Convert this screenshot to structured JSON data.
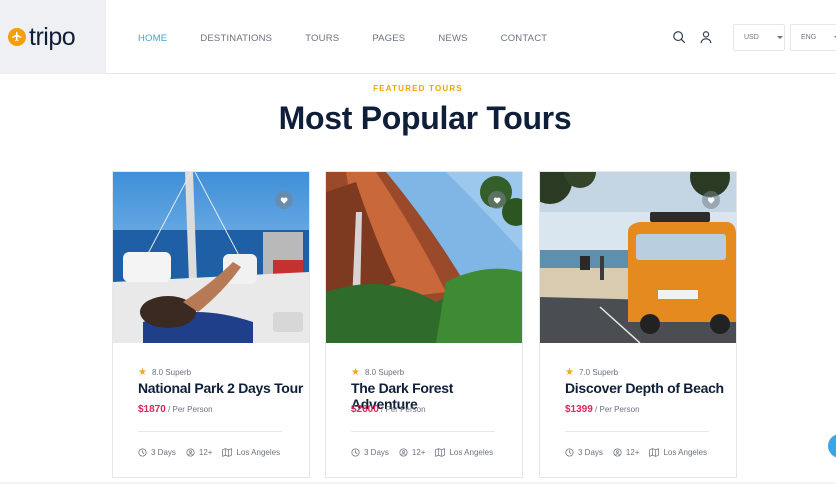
{
  "brand": {
    "name": "tripo",
    "accent": "#f59e0b"
  },
  "nav": {
    "items": [
      {
        "label": "HOME",
        "active": true
      },
      {
        "label": "DESTINATIONS",
        "active": false
      },
      {
        "label": "TOURS",
        "active": false
      },
      {
        "label": "PAGES",
        "active": false
      },
      {
        "label": "NEWS",
        "active": false
      },
      {
        "label": "CONTACT",
        "active": false
      }
    ]
  },
  "header": {
    "icons": [
      "search-icon",
      "user-icon"
    ],
    "currency": "USD",
    "language": "ENG"
  },
  "section": {
    "eyebrow": "FEATURED TOURS",
    "title": "Most Popular Tours"
  },
  "tours": [
    {
      "rating": "8.0 Superb",
      "title": "National Park 2 Days Tour",
      "price": "$1870",
      "per": "/ Per Person",
      "duration": "3 Days",
      "age": "12+",
      "location": "Los Angeles"
    },
    {
      "rating": "8.0 Superb",
      "title": "The Dark Forest Adventure",
      "price": "$2600",
      "per": "/ Per Person",
      "duration": "3 Days",
      "age": "12+",
      "location": "Los Angeles"
    },
    {
      "rating": "7.0 Superb",
      "title": "Discover Depth of Beach",
      "price": "$1399",
      "per": "/ Per Person",
      "duration": "3 Days",
      "age": "12+",
      "location": "Los Angeles"
    }
  ],
  "colors": {
    "primary": "#0f1f3a",
    "link": "#38a5dc",
    "price": "#e0245e",
    "star": "#f5a623",
    "eyebrow": "#f0a500"
  }
}
